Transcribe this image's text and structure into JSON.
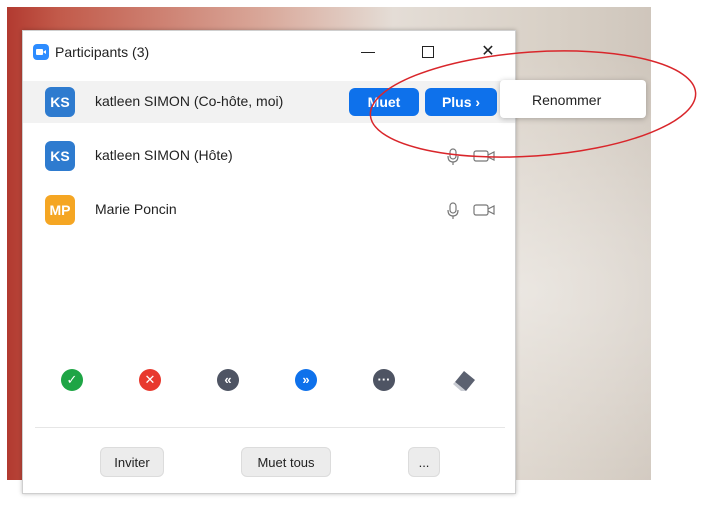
{
  "window": {
    "title": "Participants (3)",
    "close_glyph": "✕"
  },
  "participants": [
    {
      "initials": "KS",
      "name": "katleen SIMON (Co-hôte, moi)",
      "avatar_color": "#2e7bcf"
    },
    {
      "initials": "KS",
      "name": "katleen SIMON (Hôte)",
      "avatar_color": "#2e7bcf"
    },
    {
      "initials": "MP",
      "name": "Marie Poncin",
      "avatar_color": "#f5a623"
    }
  ],
  "row_buttons": {
    "mute": "Muet",
    "more": "Plus ›"
  },
  "context_menu": {
    "items": [
      "Renommer"
    ]
  },
  "reactions": {
    "yes": "✓",
    "no": "✕",
    "slower": "«",
    "faster": "»",
    "more": "···"
  },
  "footer": {
    "invite": "Inviter",
    "mute_all": "Muet tous",
    "more": "..."
  },
  "colors": {
    "accent": "#0e71eb",
    "green": "#1ea545",
    "red": "#e8392e",
    "gray": "#4e5463",
    "annotation": "#d9262b"
  }
}
